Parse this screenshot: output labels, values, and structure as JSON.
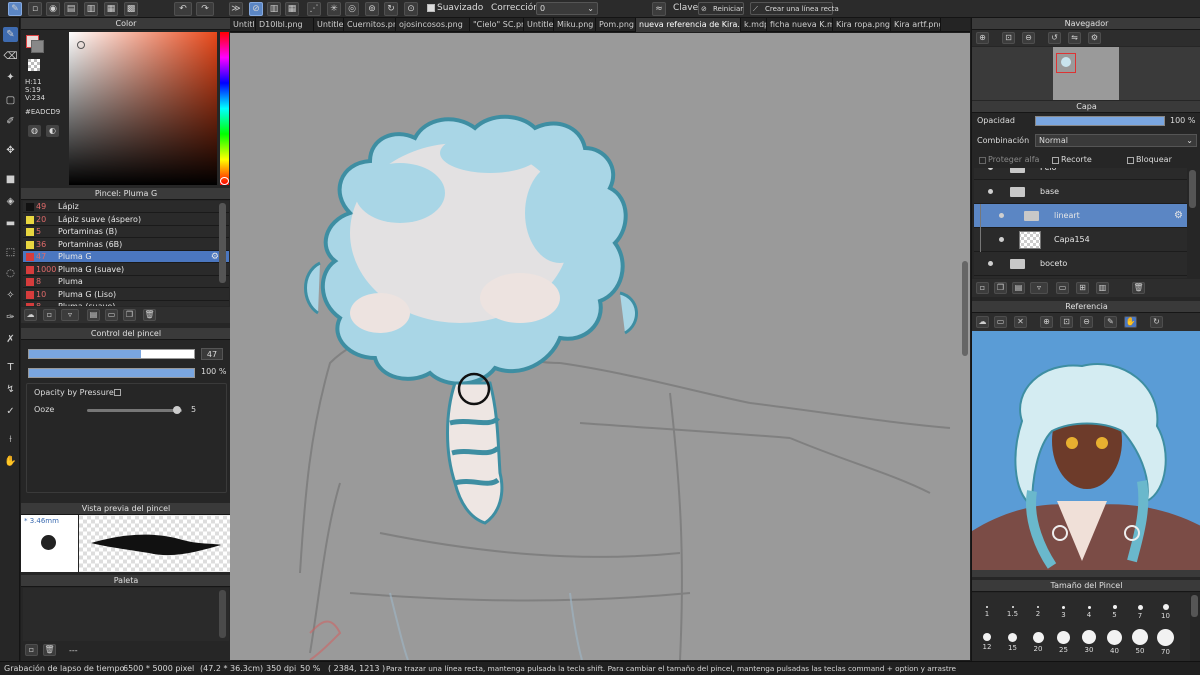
{
  "toolbar": {
    "suavizado_label": "Suavizado",
    "correccion_label": "Corrección",
    "correccion_value": "0",
    "clave_label": "Clave",
    "reiniciar_label": "Reiniciar",
    "crear_linea_label": "Crear una línea recta"
  },
  "tabs": [
    "Untitled",
    "D10lbl.png",
    "Untitled",
    "Cuernitos.png",
    "ojosincosos.png",
    "\"Cielo\" SC.png",
    "Untitled",
    "Miku.png",
    "Pom.png",
    "nueva referencia de Kira.mdp",
    "k.mdp",
    "ficha nueva K.mdp",
    "Kira ropa.png",
    "Kira artf.png"
  ],
  "color_panel": {
    "title": "Color",
    "h": "H:11",
    "s": "S:19",
    "v": "V:234",
    "hex": "#EADCD9"
  },
  "brush_panel": {
    "title": "Pincel: Pluma G",
    "items": [
      {
        "num": "49",
        "name": "Lápiz",
        "color": "#111111"
      },
      {
        "num": "20",
        "name": "Lápiz suave (áspero)",
        "color": "#e8d640"
      },
      {
        "num": "5",
        "name": "Portaminas (B)",
        "color": "#e8d640"
      },
      {
        "num": "36",
        "name": "Portaminas (6B)",
        "color": "#e8d640"
      },
      {
        "num": "47",
        "name": "Pluma G",
        "color": "#d63c3c"
      },
      {
        "num": "1000",
        "name": "Pluma G (suave)",
        "color": "#d63c3c"
      },
      {
        "num": "8",
        "name": "Pluma",
        "color": "#d63c3c"
      },
      {
        "num": "10",
        "name": "Pluma G (Liso)",
        "color": "#d63c3c"
      },
      {
        "num": "8",
        "name": "Pluma (suave)",
        "color": "#d63c3c"
      }
    ]
  },
  "brush_control": {
    "title": "Control del pincel",
    "size_value": "47",
    "opacity_value": "100 %",
    "opacity_by_pressure": "Opacity by Pressure",
    "ooze_label": "Ooze",
    "ooze_value": "5",
    "size_fraction": 0.68,
    "opacity_fraction": 1.0,
    "ooze_fraction": 0.95
  },
  "brush_preview": {
    "title": "Vista previa del pincel",
    "size": "* 3.46mm"
  },
  "palette": {
    "title": "Paleta",
    "footer": "---"
  },
  "navigator": {
    "title": "Navegador"
  },
  "layers": {
    "title": "Capa",
    "opacity_label": "Opacidad",
    "opacity_value": "100 %",
    "opacity_fraction": 1.0,
    "blend_label": "Combinación",
    "blend_value": "Normal",
    "lock_alpha": "Proteger alfa",
    "clip": "Recorte",
    "lock": "Bloquear",
    "items": [
      {
        "name": "Pelo",
        "type": "folder",
        "indent": 0,
        "selected": false
      },
      {
        "name": "base",
        "type": "folder",
        "indent": 0,
        "selected": false
      },
      {
        "name": "lineart",
        "type": "folder",
        "indent": 1,
        "selected": true
      },
      {
        "name": "Capa154",
        "type": "layer",
        "indent": 1,
        "selected": false
      },
      {
        "name": "boceto",
        "type": "folder",
        "indent": 0,
        "selected": false
      }
    ]
  },
  "reference": {
    "title": "Referencia"
  },
  "brush_sizes": {
    "title": "Tamaño del Pincel",
    "row1": [
      "1",
      "1.5",
      "2",
      "3",
      "4",
      "5",
      "7",
      "10"
    ],
    "row2": [
      "12",
      "15",
      "20",
      "25",
      "30",
      "40",
      "50",
      "70"
    ]
  },
  "status": {
    "lapse": "Grabación de lapso de tiempo",
    "dims": "6500 * 5000 pixel",
    "cm": "(47.2 * 36.3cm)",
    "dpi": "350 dpi",
    "zoom": "50 %",
    "coords": "( 2384, 1213 )",
    "hint": "Para trazar una línea recta, mantenga pulsada la tecla shift. Para cambiar el tamaño del pincel, mantenga pulsadas las teclas command + option y arrastre"
  },
  "colors": {
    "accent": "#5b86c4",
    "canvas_bg": "#9a9a9a",
    "hair_blue": "#a9d6e6",
    "hair_outline": "#3e8ea2",
    "foreground": "#eadcd9"
  }
}
